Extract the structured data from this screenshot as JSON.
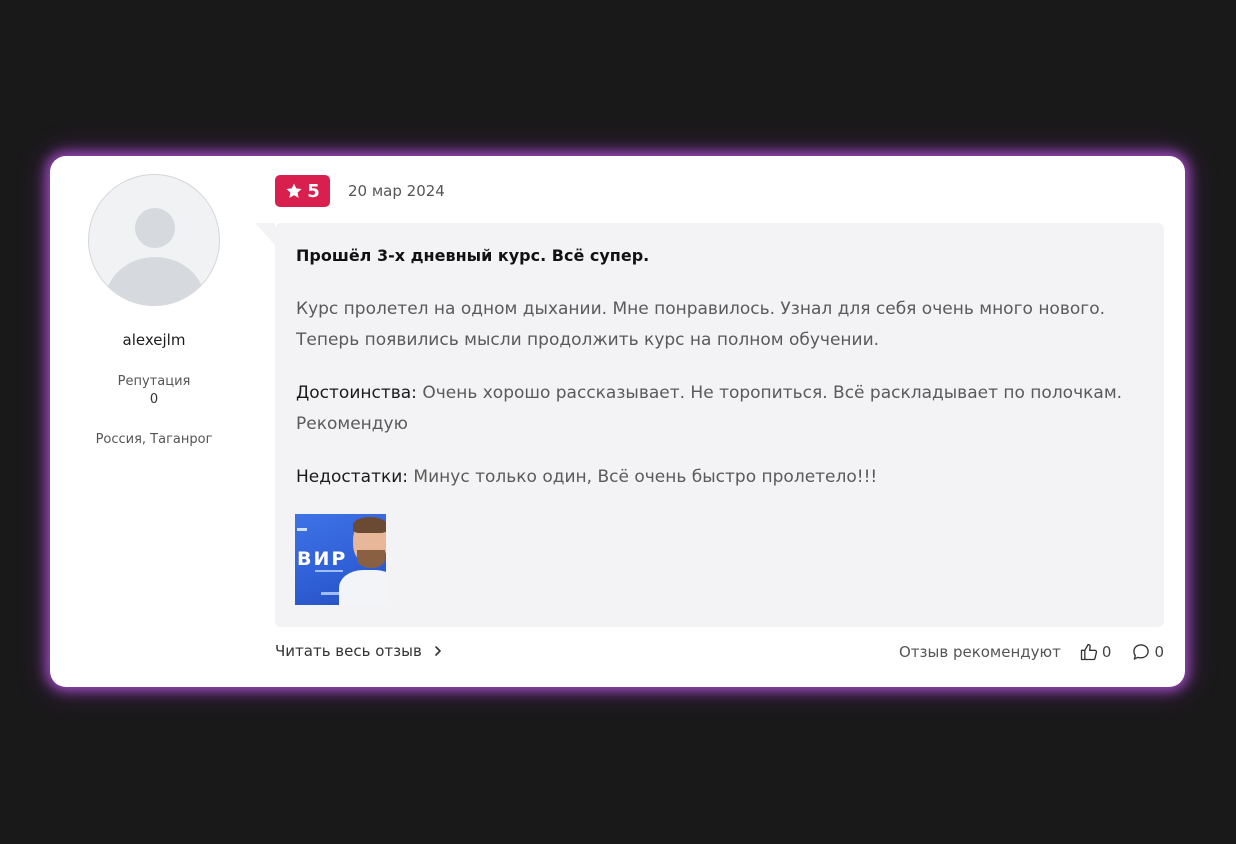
{
  "review": {
    "rating": "5",
    "date": "20 мар 2024",
    "title": "Прошёл 3-х дневный курс. Всё супер.",
    "text": "Курс пролетел на одном дыхании. Мне понравилось. Узнал для себя очень много нового. Теперь появились мысли продолжить курс на полном обучении.",
    "pros_label": "Достоинства:",
    "pros_text": "Очень хорошо рассказывает. Не торопиться. Всё раскладывает по полочкам. Рекомендую",
    "cons_label": "Недостатки:",
    "cons_text": "Минус только один, Всё очень быстро пролетело!!!",
    "image_text": "ВИР"
  },
  "author": {
    "username": "alexejlm",
    "reputation_label": "Репутация",
    "reputation_value": "0",
    "location": "Россия, Таганрог"
  },
  "footer": {
    "read_more": "Читать весь отзыв",
    "recommend_label": "Отзыв рекомендуют",
    "likes": "0",
    "comments": "0"
  },
  "colors": {
    "rating_badge": "#d81f4e",
    "card_glow": "#be5ae6",
    "bubble": "#f3f3f5"
  },
  "icons": [
    "user-avatar-icon",
    "star-icon",
    "chevron-right-icon",
    "thumbs-up-icon",
    "comment-icon"
  ]
}
